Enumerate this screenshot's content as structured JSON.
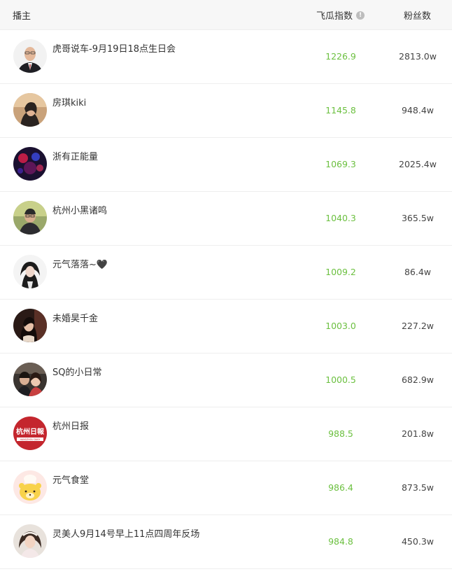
{
  "header": {
    "streamer": "播主",
    "index": "飞瓜指数",
    "info_icon": "!",
    "fans": "粉丝数"
  },
  "rows": [
    {
      "name": "虎哥说车-9月19日18点生日会",
      "index": "1226.9",
      "fans": "2813.0w"
    },
    {
      "name": "房琪kiki",
      "index": "1145.8",
      "fans": "948.4w"
    },
    {
      "name": "浙有正能量",
      "index": "1069.3",
      "fans": "2025.4w"
    },
    {
      "name": "杭州小黑诸鸣",
      "index": "1040.3",
      "fans": "365.5w"
    },
    {
      "name": "元气落落~🖤",
      "index": "1009.2",
      "fans": "86.4w"
    },
    {
      "name": "未婚昊千金",
      "index": "1003.0",
      "fans": "227.2w"
    },
    {
      "name": "SQ的小日常",
      "index": "1000.5",
      "fans": "682.9w"
    },
    {
      "name": "杭州日报",
      "index": "988.5",
      "fans": "201.8w",
      "avatar_text": "杭州日報",
      "avatar_subtext": "HANGZHOU DAILY"
    },
    {
      "name": "元气食堂",
      "index": "986.4",
      "fans": "873.5w"
    },
    {
      "name": "灵美人9月14号早上11点四周年反场",
      "index": "984.8",
      "fans": "450.3w"
    }
  ],
  "colors": {
    "index_green": "#6cc040",
    "header_bg": "#f7f7f7",
    "divider": "#eeeeee"
  }
}
